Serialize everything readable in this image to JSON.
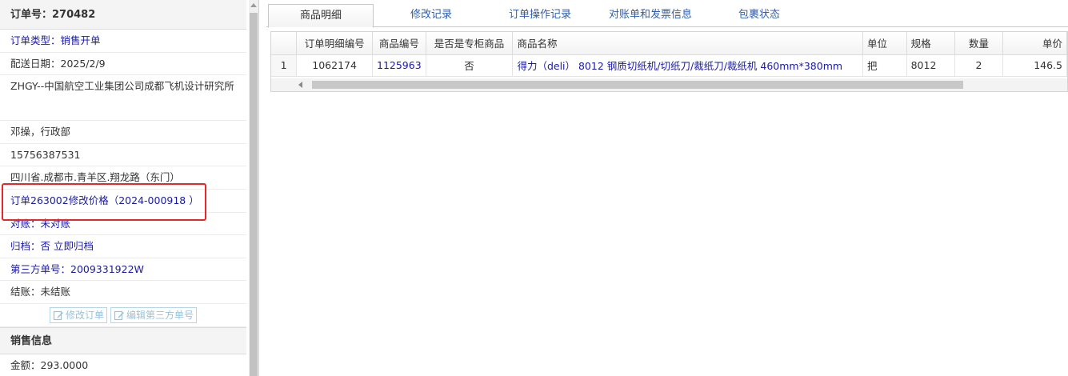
{
  "left_panel": {
    "order_no": "订单号：270482",
    "order_type": "订单类型：销售开单",
    "delivery_date": "配送日期：2025/2/9",
    "customer": "ZHGY--中国航空工业集团公司成都飞机设计研究所",
    "contact": "邓操，行政部",
    "phone": "15756387531",
    "address": "四川省.成都市.青羊区.翔龙路（东门）",
    "price_change": "订单263002修改价格（2024-000918 ）",
    "reconcile": "对账：未对账",
    "archive_label": "归档：",
    "archive_value": "否 立即归档",
    "third_party": "第三方单号：2009331922W",
    "settlement": "结账：未结账",
    "edit_order_btn": "修改订单",
    "edit_third_btn": "编辑第三方单号",
    "sales_section": "销售信息",
    "amount": "金额：293.0000"
  },
  "tabs": [
    "商品明细",
    "修改记录",
    "订单操作记录",
    "对账单和发票信息",
    "包裹状态"
  ],
  "table": {
    "columns": [
      "",
      "订单明细编号",
      "商品编号",
      "是否是专柜商品",
      "商品名称",
      "单位",
      "规格",
      "数量",
      "单价"
    ],
    "rows": [
      [
        "1",
        "1062174",
        "1125963",
        "否",
        "得力（deli） 8012 钢质切纸机/切纸刀/裁纸刀/裁纸机 460mm*380mm",
        "把",
        "8012",
        "2",
        "146.5"
      ]
    ]
  },
  "colors": {
    "link": "#1a1aa6",
    "highlight": "#e5282a"
  }
}
